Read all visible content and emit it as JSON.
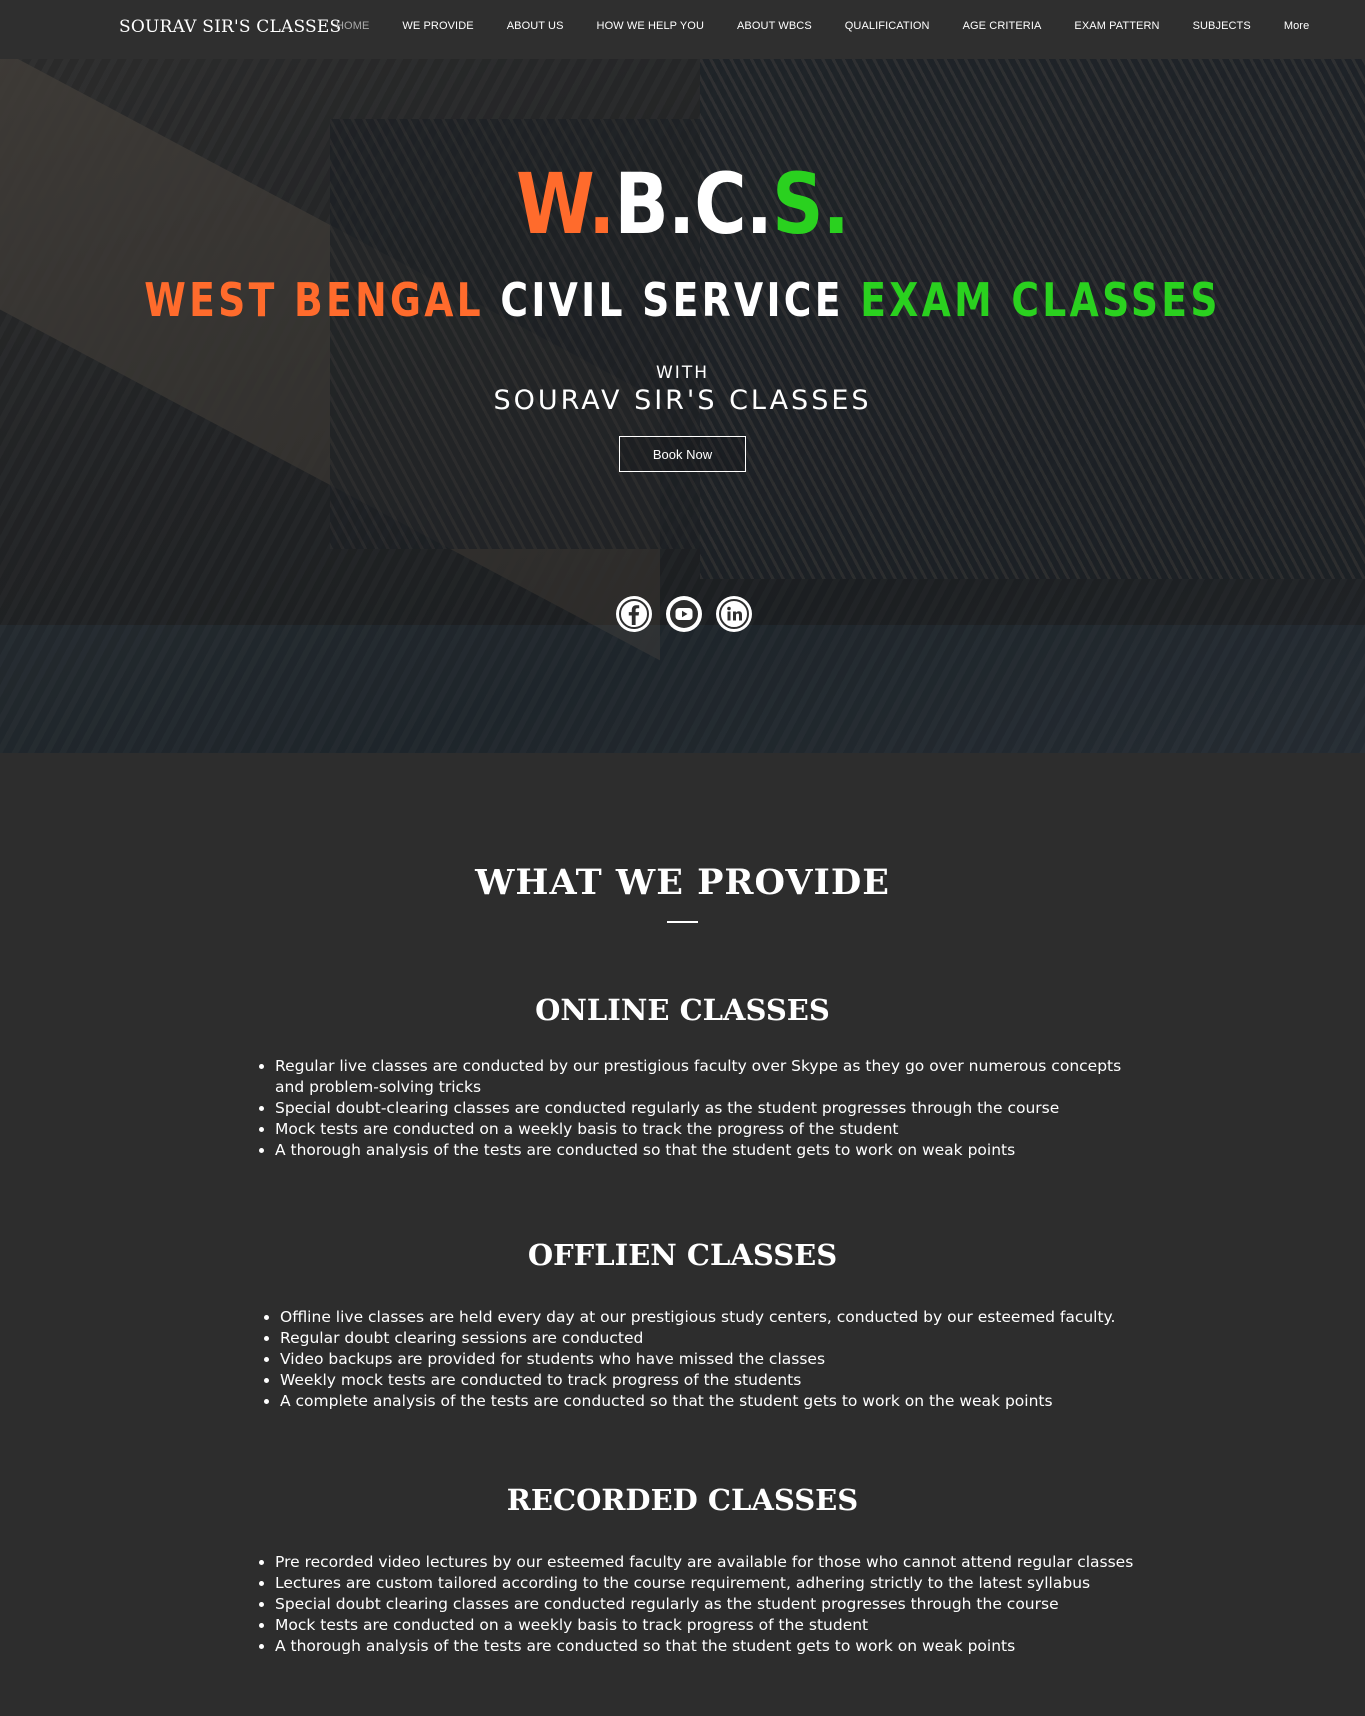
{
  "header": {
    "brand": "SOURAV SIR'S CLASSES",
    "nav": [
      {
        "label": "HOME",
        "active": true
      },
      {
        "label": "WE PROVIDE"
      },
      {
        "label": "ABOUT US"
      },
      {
        "label": "HOW WE HELP YOU"
      },
      {
        "label": "ABOUT WBCS"
      },
      {
        "label": "QUALIFICATION"
      },
      {
        "label": "AGE CRITERIA"
      },
      {
        "label": "EXAM PATTERN"
      },
      {
        "label": "SUBJECTS"
      },
      {
        "label": "More"
      }
    ]
  },
  "hero": {
    "logo": {
      "w": "W.",
      "bc": "B.C.",
      "s": "S."
    },
    "tagline": {
      "part1": "WEST BENGAL ",
      "part2": "CIVIL SERVICE ",
      "part3": "EXAM CLASSES"
    },
    "with_label": "WITH",
    "sub_brand": "SOURAV SIR'S CLASSES",
    "cta_label": "Book Now",
    "social": [
      "facebook-icon",
      "youtube-icon",
      "linkedin-icon"
    ],
    "colors": {
      "orange": "#ff6b2c",
      "green": "#2ad11f",
      "white": "#ffffff"
    }
  },
  "provide": {
    "title": "WHAT WE PROVIDE",
    "online": {
      "title": "ONLINE CLASSES",
      "items": [
        "Regular live classes are conducted by our prestigious faculty over Skype as they go over numerous concepts and problem-solving tricks",
        "Special doubt-clearing classes are conducted regularly as the student progresses through the course",
        "Mock tests are conducted on a weekly basis to track the progress of the student",
        "A thorough analysis of the tests are conducted so that the student gets to work on weak points"
      ]
    },
    "offline": {
      "title": "OFFLIEN CLASSES",
      "items": [
        "Offline live classes are held every day at our prestigious study centers, conducted by our esteemed faculty.",
        "Regular doubt clearing sessions are conducted",
        "Video backups are provided for students who have missed the classes",
        "Weekly mock tests are conducted to track progress of the students",
        "A complete analysis of the tests are conducted so that the student gets to work on the weak points"
      ]
    },
    "recorded": {
      "title": "RECORDED CLASSES",
      "items": [
        "Pre recorded video lectures by our esteemed faculty are available for those who cannot attend regular classes",
        "Lectures are custom tailored according to the course requirement, adhering strictly to the latest syllabus",
        "Special doubt clearing classes are conducted regularly as the student progresses through the course",
        "Mock tests are conducted on a weekly basis to track progress of the student",
        "A thorough analysis of the tests are conducted so that the student gets to work on weak points"
      ]
    }
  }
}
